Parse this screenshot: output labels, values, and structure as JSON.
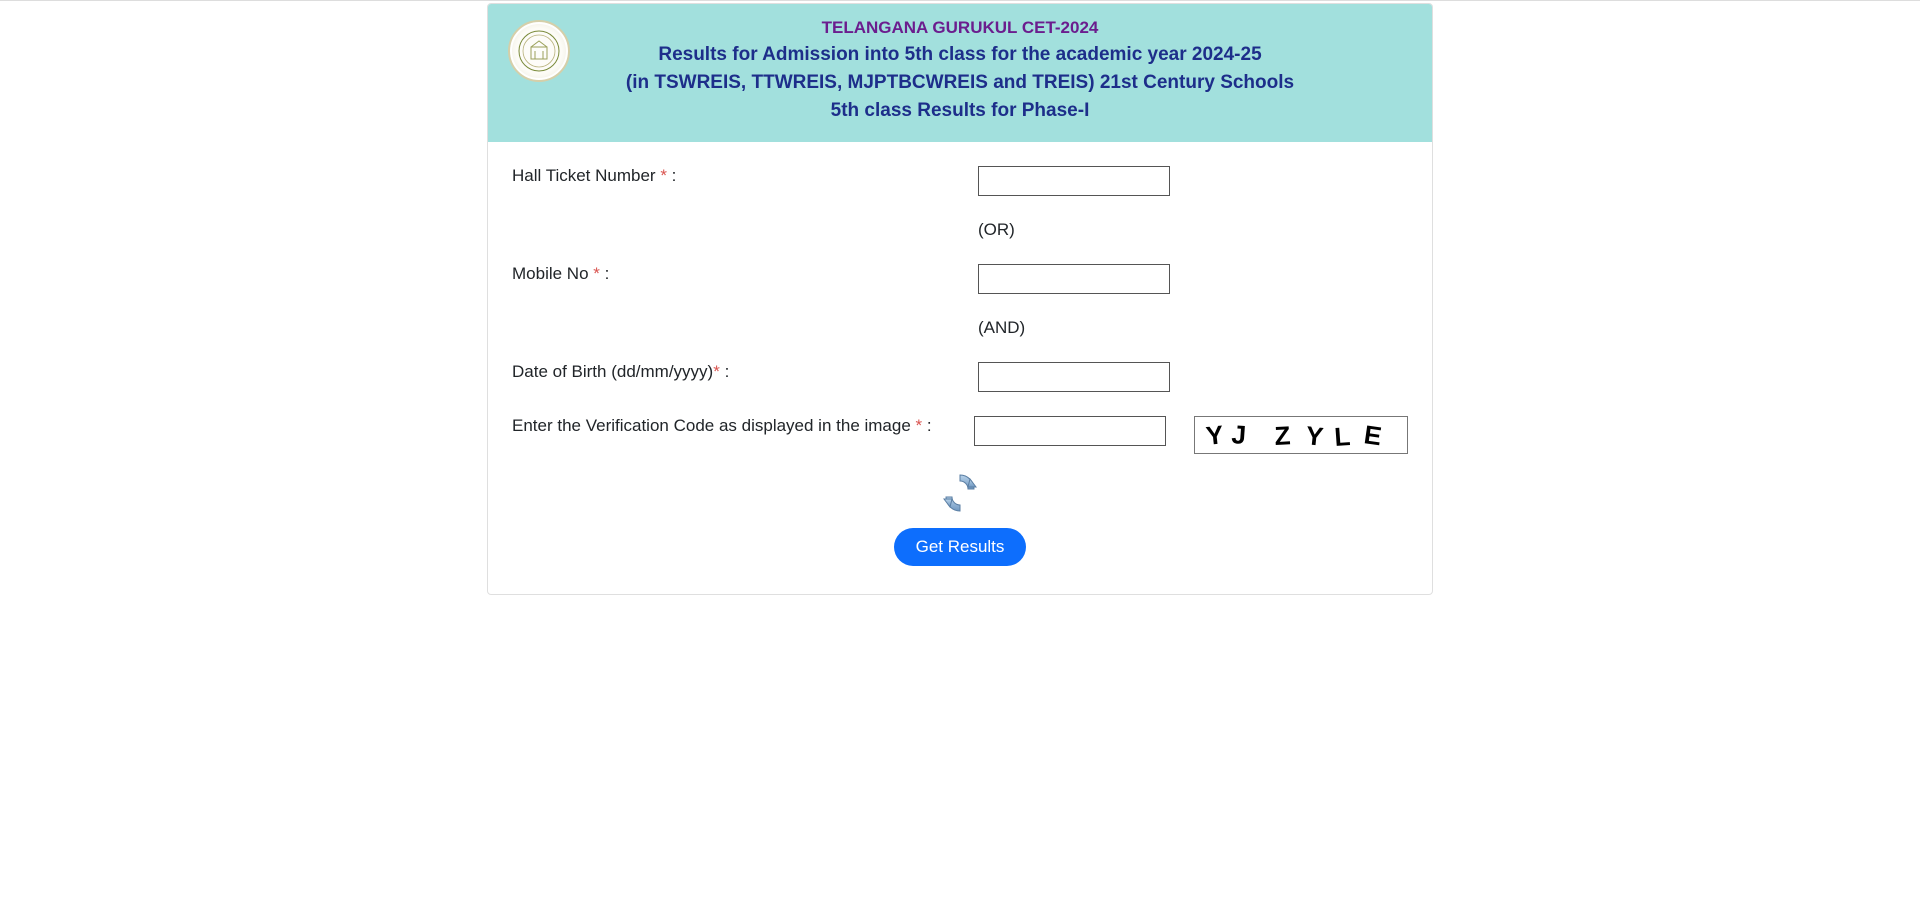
{
  "header": {
    "line1": "TELANGANA GURUKUL CET-2024",
    "line2": "Results for Admission into 5th class for the academic year 2024-25",
    "line3": "(in TSWREIS, TTWREIS, MJPTBCWREIS and TREIS) 21st Century Schools",
    "line4": "5th class Results for Phase-I"
  },
  "form": {
    "hall_ticket_label": "Hall Ticket Number ",
    "or_text": "(OR)",
    "mobile_label": "Mobile No ",
    "and_text": "(AND)",
    "dob_label": "Date of Birth (dd/mm/yyyy)",
    "captcha_label": "Enter the Verification Code as displayed in the image ",
    "colon": " :",
    "asterisk": "*",
    "captcha_value": "YJ ZYLE",
    "submit_label": "Get Results"
  }
}
